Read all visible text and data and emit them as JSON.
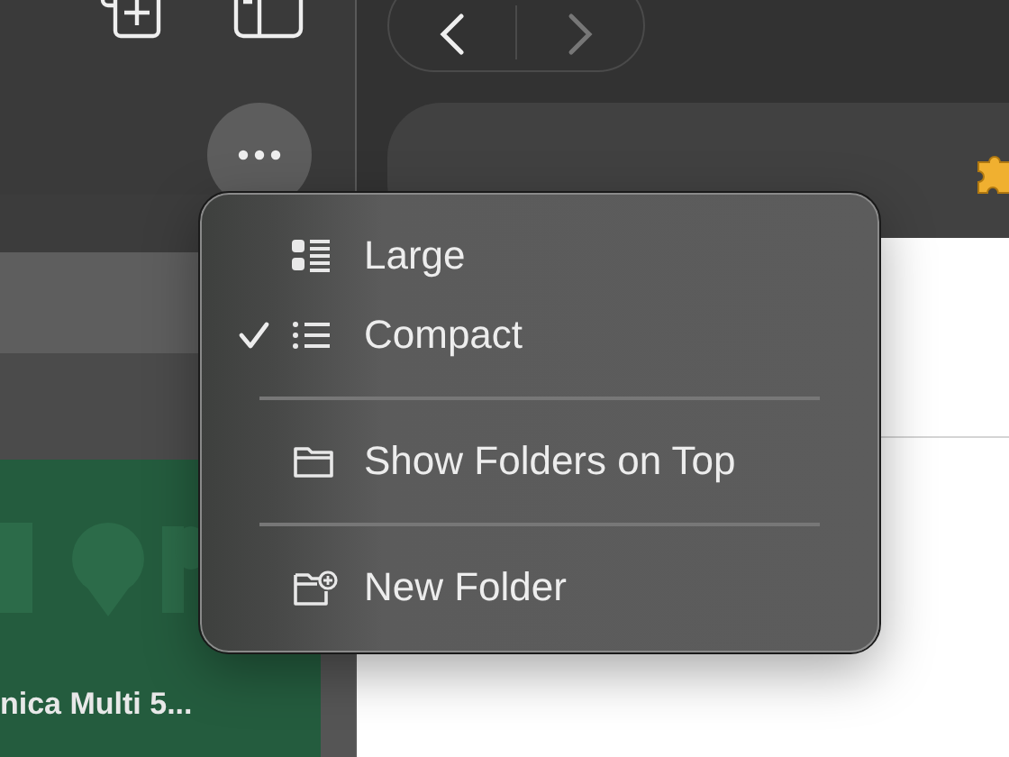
{
  "sidebar": {
    "card": {
      "title": "nica Multi 5..."
    }
  },
  "menu": {
    "items": [
      {
        "kind": "option",
        "label": "Large",
        "checked": false
      },
      {
        "kind": "option",
        "label": "Compact",
        "checked": true
      },
      {
        "kind": "separator"
      },
      {
        "kind": "action",
        "label": "Show Folders on Top"
      },
      {
        "kind": "separator"
      },
      {
        "kind": "action",
        "label": "New Folder"
      }
    ]
  }
}
